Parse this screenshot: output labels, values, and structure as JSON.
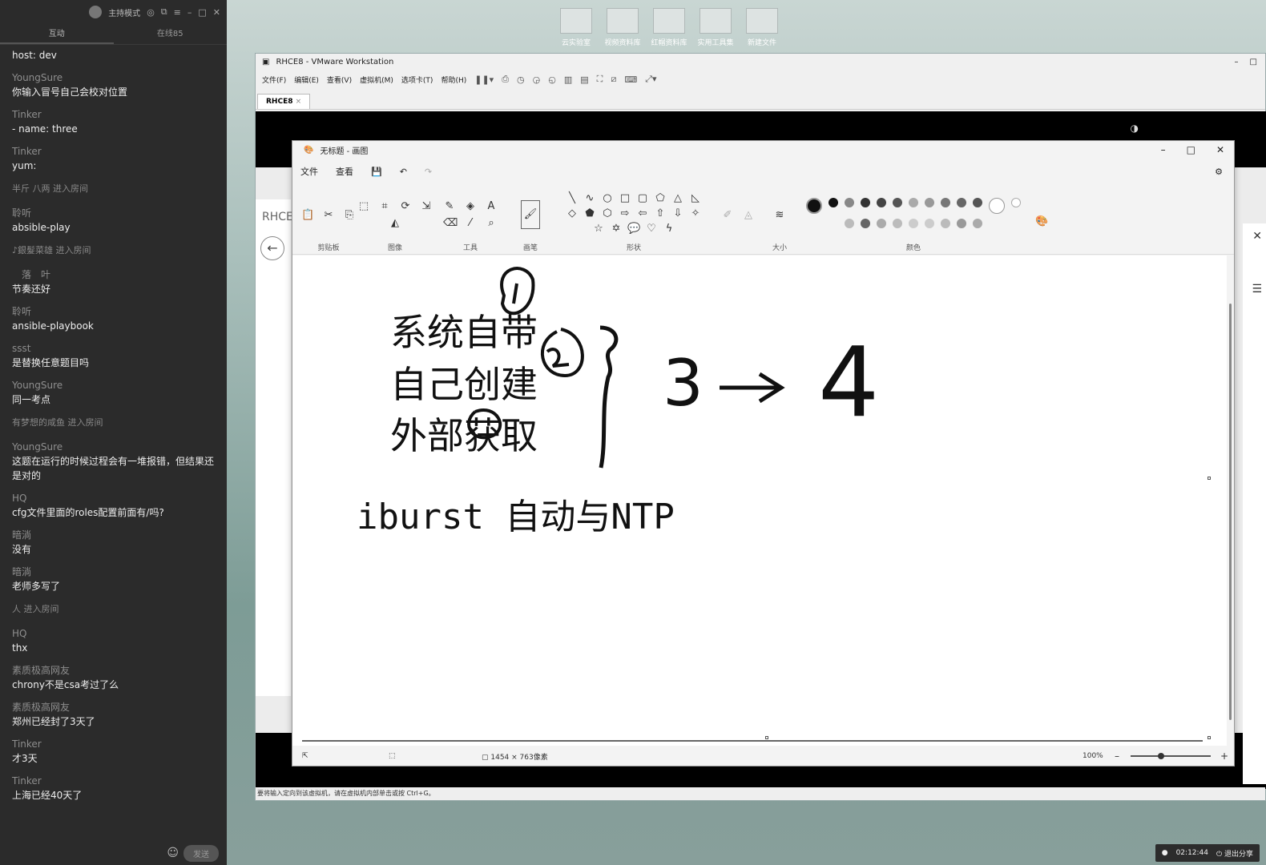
{
  "chat": {
    "mode_label": "主持模式",
    "tabs": [
      {
        "label": "互动"
      },
      {
        "label": "在线85"
      }
    ],
    "messages": [
      {
        "kind": "text",
        "who": "",
        "text": "host: dev"
      },
      {
        "kind": "text",
        "who": "YoungSure",
        "text": "你输入冒号自己会校对位置"
      },
      {
        "kind": "text",
        "who": "Tinker",
        "text": "- name: three"
      },
      {
        "kind": "text",
        "who": "Tinker",
        "text": "yum:"
      },
      {
        "kind": "sys",
        "text": "半斤 八两 进入房间"
      },
      {
        "kind": "text",
        "who": "聆听",
        "text": "absible-play"
      },
      {
        "kind": "sys",
        "text": "♪銀髮菜雄 进入房间"
      },
      {
        "kind": "text",
        "who": "　落　叶",
        "text": "节奏还好"
      },
      {
        "kind": "text",
        "who": "聆听",
        "text": "ansible-playbook"
      },
      {
        "kind": "text",
        "who": "ssst",
        "text": "是替换任意题目吗"
      },
      {
        "kind": "text",
        "who": "YoungSure",
        "text": "同一考点"
      },
      {
        "kind": "sys",
        "text": "有梦想的咸鱼 进入房间"
      },
      {
        "kind": "text",
        "who": "YoungSure",
        "text": "这题在运行的时候过程会有一堆报错，但结果还是对的"
      },
      {
        "kind": "text",
        "who": "HQ",
        "text": "cfg文件里面的roles配置前面有/吗?"
      },
      {
        "kind": "text",
        "who": "暗淌",
        "text": "没有"
      },
      {
        "kind": "text",
        "who": "暗淌",
        "text": "老师多写了"
      },
      {
        "kind": "sys",
        "text": "人 进入房间"
      },
      {
        "kind": "text",
        "who": "HQ",
        "text": "thx"
      },
      {
        "kind": "text",
        "who": "素质极高网友",
        "text": "chrony不是csa考过了么"
      },
      {
        "kind": "text",
        "who": "素质极高网友",
        "text": "郑州已经封了3天了"
      },
      {
        "kind": "text",
        "who": "Tinker",
        "text": "才3天"
      },
      {
        "kind": "text",
        "who": "Tinker",
        "text": "上海已经40天了"
      }
    ],
    "send_label": "发送"
  },
  "desktop_icons": [
    "云实验室",
    "视频资料库",
    "红帽资料库",
    "实用工具集",
    "新建文件"
  ],
  "vmware": {
    "title": "RHCE8 - VMware Workstation",
    "menu": [
      "文件(F)",
      "编辑(E)",
      "查看(V)",
      "虚拟机(M)",
      "选项卡(T)",
      "帮助(H)"
    ],
    "tab": "RHCE8",
    "status": "要将输入定向到该虚拟机，请在虚拟机内部单击或按 Ctrl+G。",
    "guest_label": "RHCE"
  },
  "paint": {
    "title": "无标题 - 画图",
    "menu": [
      "文件",
      "查看"
    ],
    "groups": [
      "剪贴板",
      "图像",
      "工具",
      "画笔",
      "形状",
      "大小",
      "颜色"
    ],
    "canvas_lines": [
      "系统自带",
      "自己创建",
      "外部获取"
    ],
    "arrow_from": "3",
    "arrow_to": "4",
    "canvas_text2": "iburst 自动与NTP",
    "status_size": "1454 × 763像素",
    "zoom": "100%"
  },
  "tray": {
    "time": "02:12:44",
    "exit_label": "退出分享"
  }
}
